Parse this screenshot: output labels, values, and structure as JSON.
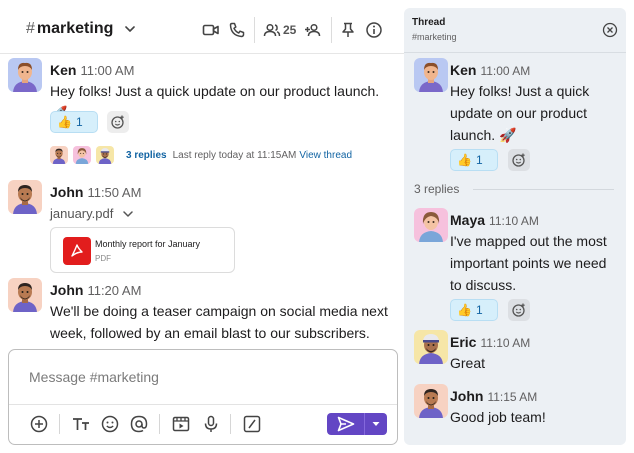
{
  "channel": {
    "hash": "#",
    "name": "marketing",
    "member_count": "25"
  },
  "messages": [
    {
      "author": "Ken",
      "time": "11:00 AM",
      "text": "Hey folks! Just a quick update on our product launch. 🚀",
      "reaction": {
        "emoji": "👍",
        "count": "1"
      },
      "thread": {
        "replies": "3 replies",
        "last_reply": "Last reply today at 11:15AM",
        "view": "View thread"
      }
    },
    {
      "author": "John",
      "time": "11:50 AM",
      "file_name": "january.pdf",
      "file_title": "Monthly report for January",
      "file_type": "PDF"
    },
    {
      "author": "John",
      "time": "11:20 AM",
      "text": "We'll be doing a teaser campaign on social media next week, followed by an email blast to our subscribers."
    }
  ],
  "composer": {
    "placeholder": "Message #marketing"
  },
  "thread_pane": {
    "title": "Thread",
    "subtitle": "#marketing",
    "parent": {
      "author": "Ken",
      "time": "11:00 AM",
      "text": "Hey folks! Just a quick update on our product launch. 🚀",
      "reaction": {
        "emoji": "👍",
        "count": "1"
      }
    },
    "replies_label": "3 replies",
    "replies": [
      {
        "author": "Maya",
        "time": "11:10 AM",
        "text": "I've mapped out the most important points we need to discuss.",
        "reaction": {
          "emoji": "👍",
          "count": "1"
        }
      },
      {
        "author": "Eric",
        "time": "11:10 AM",
        "text": "Great"
      },
      {
        "author": "John",
        "time": "11:15 AM",
        "text": "Good job team!"
      }
    ]
  },
  "colors": {
    "accent": "#6346c4",
    "link": "#1264a3",
    "reaction_bg": "#d6effb",
    "thread_bg": "#ecf0f4",
    "pdf_red": "#e21d1d"
  },
  "icons": {
    "header": [
      "video-icon",
      "phone-icon",
      "members-icon",
      "add-member-icon",
      "pin-icon",
      "info-icon"
    ],
    "composer": [
      "plus-icon",
      "text-format-icon",
      "emoji-icon",
      "mention-icon",
      "video-clip-icon",
      "mic-icon",
      "slash-command-icon",
      "send-icon",
      "chevron-down-icon"
    ]
  }
}
